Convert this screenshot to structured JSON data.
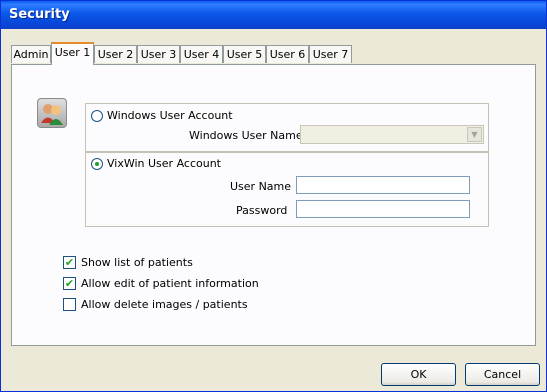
{
  "window": {
    "title": "Security"
  },
  "tabs": [
    "Admin",
    "User 1",
    "User 2",
    "User 3",
    "User 4",
    "User 5",
    "User 6",
    "User 7"
  ],
  "active_tab": "User 1",
  "account": {
    "windows_account": {
      "label": "Windows User Account",
      "selected": false,
      "user_name_label": "Windows User Name",
      "user_name_value": ""
    },
    "vixwin_account": {
      "label": "VixWin User Account",
      "selected": true,
      "user_name_label": "User Name",
      "user_name_value": "",
      "password_label": "Password",
      "password_value": ""
    }
  },
  "permissions": [
    {
      "label": "Show list of patients",
      "checked": true
    },
    {
      "label": "Allow edit of patient information",
      "checked": true
    },
    {
      "label": "Allow delete images / patients",
      "checked": false
    }
  ],
  "buttons": {
    "ok": "OK",
    "cancel": "Cancel"
  },
  "icons": {
    "users": "users-icon",
    "check": "✔"
  },
  "colors": {
    "titlebar": "#0a58e8",
    "face": "#ece9d8",
    "tab_accent": "#e68b2c"
  }
}
